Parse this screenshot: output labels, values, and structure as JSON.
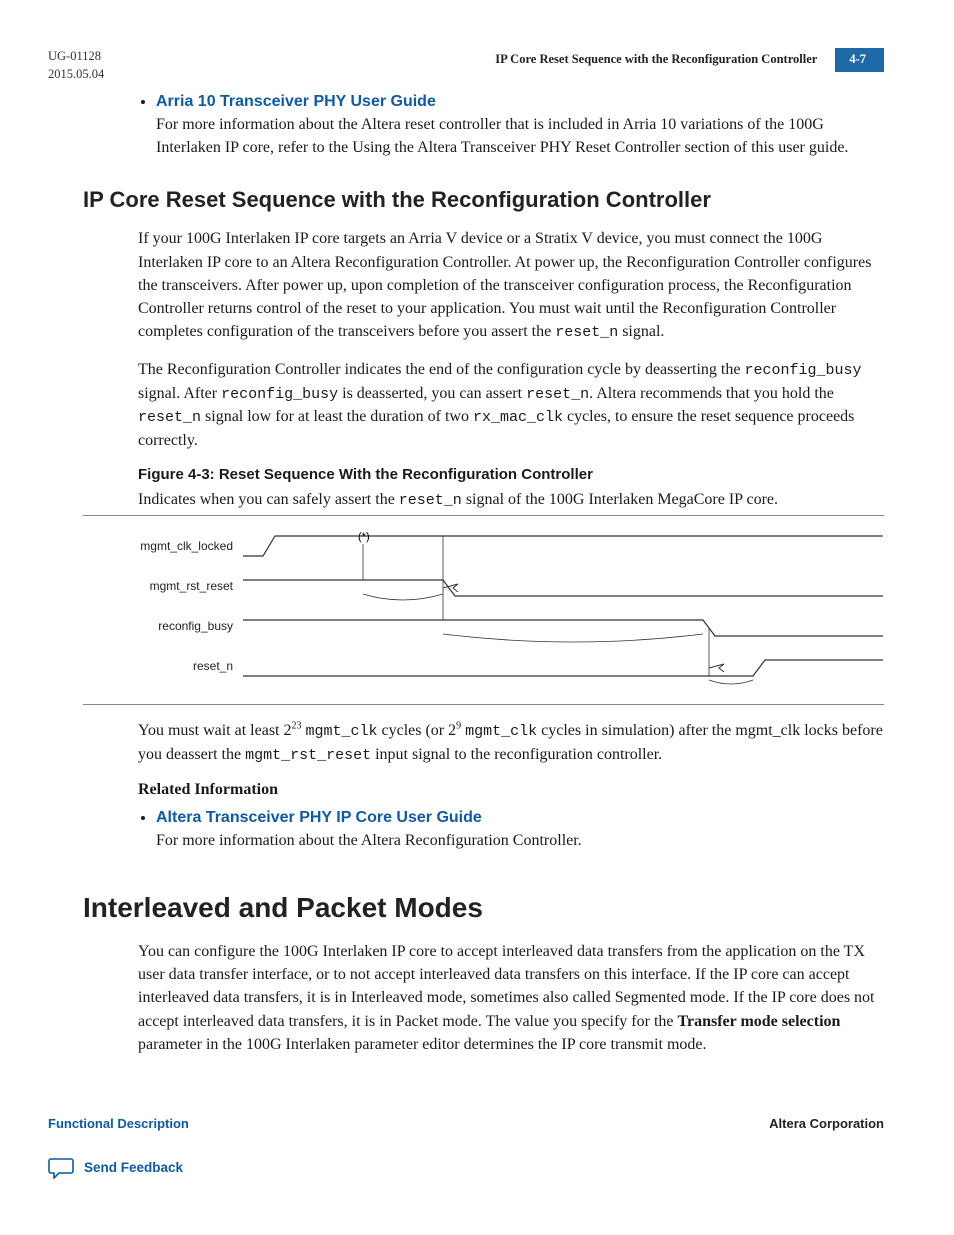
{
  "header": {
    "doc_id": "UG-01128",
    "date": "2015.05.04",
    "running_title": "IP Core Reset Sequence with the Reconfiguration Controller",
    "page": "4-7"
  },
  "top_list": {
    "link": "Arria 10 Transceiver PHY User Guide",
    "desc": "For more information about the Altera reset controller that is included in Arria 10 variations of the 100G Interlaken IP core, refer to the Using the Altera Transceiver PHY Reset Controller section of this user guide."
  },
  "sec1": {
    "title": "IP Core Reset Sequence with the Reconfiguration Controller",
    "p1_a": "If your 100G Interlaken IP core targets an Arria V device or a Stratix V device, you must connect the 100G Interlaken IP core to an Altera Reconfiguration Controller. At power up, the Reconfiguration Controller configures the transceivers. After power up, upon completion of the transceiver configuration process, the Reconfiguration Controller returns control of the reset to your application. You must wait until the Reconfiguration Controller completes configuration of the transceivers before you assert the ",
    "p1_m1": "reset_n",
    "p1_b": " signal.",
    "p2_a": "The Reconfiguration Controller indicates the end of the configuration cycle by deasserting the ",
    "p2_m1": "reconfig_busy",
    "p2_b": " signal. After ",
    "p2_m2": "reconfig_busy",
    "p2_c": " is deasserted, you can assert ",
    "p2_m3": "reset_n",
    "p2_d": ". Altera recommends that you hold the ",
    "p2_m4": "reset_n",
    "p2_e": " signal low for at least the duration of two ",
    "p2_m5": "rx_mac_clk",
    "p2_f": " cycles, to ensure the reset sequence proceeds correctly.",
    "figcap": "Figure 4-3: Reset Sequence With the Reconfiguration Controller",
    "figtop_a": "Indicates when you can safely assert the ",
    "figtop_m": "reset_n",
    "figtop_b": " signal of the 100G Interlaken MegaCore IP core.",
    "signals": {
      "s1": "mgmt_clk_locked",
      "s2": "mgmt_rst_reset",
      "s3": "reconfig_busy",
      "s4": "reset_n",
      "marker": "(*)"
    },
    "after_a": "You must wait at least 2",
    "after_sup1": "23",
    "after_b": " ",
    "after_m1": "mgmt_clk",
    "after_c": " cycles (or 2",
    "after_sup2": "9",
    "after_d": " ",
    "after_m2": "mgmt_clk",
    "after_e": " cycles in simulation) after the mgmt_clk locks before you deassert the ",
    "after_m3": "mgmt_rst_reset",
    "after_f": " input signal to the reconfiguration controller.",
    "relhdr": "Related Information",
    "rel_link": "Altera Transceiver PHY IP Core User Guide",
    "rel_desc": "For more information about the Altera Reconfiguration Controller."
  },
  "sec2": {
    "title": "Interleaved and Packet Modes",
    "p_a": "You can configure the 100G Interlaken IP core to accept interleaved data transfers from the application on the TX user data transfer interface, or to not accept interleaved data transfers on this interface. If the IP core can accept interleaved data transfers, it is in Interleaved mode, sometimes also called Segmented mode. If the IP core does not accept interleaved data transfers, it is in Packet mode. The value you specify for the ",
    "p_bold": "Transfer mode selection",
    "p_b": " parameter in the 100G Interlaken parameter editor determines the IP core transmit mode."
  },
  "footer": {
    "left": "Functional Description",
    "right": "Altera Corporation",
    "feedback": "Send Feedback"
  }
}
